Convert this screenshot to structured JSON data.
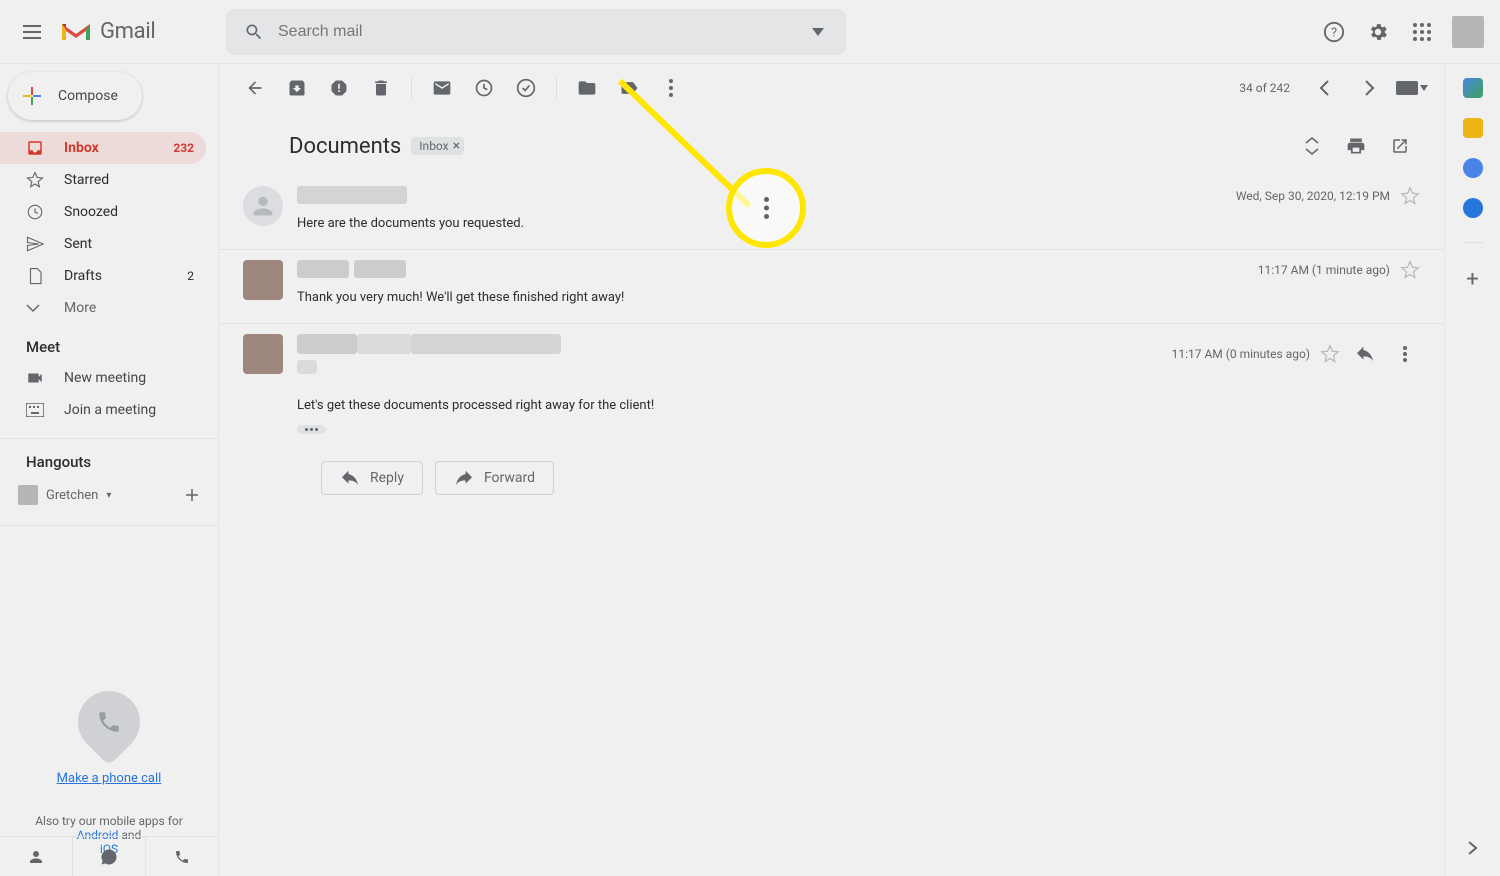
{
  "app": {
    "name": "Gmail"
  },
  "search": {
    "placeholder": "Search mail"
  },
  "compose": {
    "label": "Compose"
  },
  "nav": {
    "inbox": {
      "label": "Inbox",
      "count": "232"
    },
    "starred": {
      "label": "Starred"
    },
    "snoozed": {
      "label": "Snoozed"
    },
    "sent": {
      "label": "Sent"
    },
    "drafts": {
      "label": "Drafts",
      "count": "2"
    },
    "more": {
      "label": "More"
    }
  },
  "meet": {
    "header": "Meet",
    "new_meeting": "New meeting",
    "join_meeting": "Join a meeting"
  },
  "hangouts": {
    "header": "Hangouts",
    "user": "Gretchen"
  },
  "phone": {
    "link": "Make a phone call",
    "try_prefix": "Also try our mobile apps for ",
    "android": "Android",
    "and": " and ",
    "ios": "iOS"
  },
  "toolbar": {
    "counter_pos": "34",
    "counter_of": "of",
    "counter_total": "242"
  },
  "subject": {
    "title": "Documents",
    "chip_label": "Inbox"
  },
  "messages": {
    "m1": {
      "body": "Here are the documents you requested.",
      "time": "Wed, Sep 30, 2020, 12:19 PM"
    },
    "m2": {
      "body": "Thank you very much! We'll get these finished right away!",
      "time": "11:17 AM (1 minute ago)"
    },
    "m3": {
      "body": "Let's get these documents processed right away for the client!",
      "time": "11:17 AM (0 minutes ago)"
    }
  },
  "actions": {
    "reply": "Reply",
    "forward": "Forward"
  }
}
